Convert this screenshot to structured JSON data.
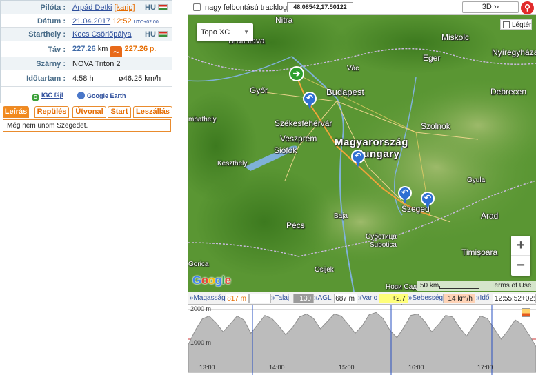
{
  "pilot": {
    "label": "Pilóta :",
    "name": "Árpád Detki",
    "nick": "[karip]",
    "country": "HU"
  },
  "date": {
    "label": "Dátum :",
    "date": "21.04.2017",
    "time": "12:52",
    "tz": "UTC+02:00"
  },
  "takeoff": {
    "label": "Starthely :",
    "name": "Kocs Csörlőpálya",
    "country": "HU"
  },
  "distance": {
    "label": "Táv :",
    "value": "227.26",
    "unit": "km",
    "points": "227.26",
    "points_unit": "p."
  },
  "glider": {
    "label": "Szárny :",
    "name": "NOVA Triton 2"
  },
  "duration": {
    "label": "Időtartam :",
    "time": "4:58 h",
    "avg": "ø46.25 km/h"
  },
  "files": {
    "igc": "IGC fájl",
    "google_earth": "Google Earth"
  },
  "tabs": [
    "Leírás",
    "Repülés",
    "Útvonal",
    "Start",
    "Leszállás"
  ],
  "active_tab": 0,
  "description": "Még nem unom Szegedet.",
  "toolbar": {
    "hires_label": "nagy felbontású tracklog",
    "coords": "48.08542,17.50122",
    "btn_3d": "3D ››"
  },
  "map": {
    "type_label": "Topo XC",
    "terrain_label": "Légtér",
    "google": "Google",
    "scale": "50 km",
    "terms": "Terms of Use",
    "zoom_in": "+",
    "zoom_out": "−",
    "cities": {
      "nitra": "Nitra",
      "bratislava": "Bratislava",
      "miskolc": "Miskolc",
      "nyiregyhaza": "Nyíregyháza",
      "eger": "Eger",
      "vac": "Vác",
      "gyor": "Győr",
      "budapest": "Budapest",
      "debrecen": "Debrecen",
      "szombathely": "mbathely",
      "szekesfehervar": "Székesfehérvár",
      "szolnok": "Szolnok",
      "veszprem": "Veszprém",
      "siofok": "Siófok",
      "country_hu": "Magyarország",
      "country_en": "Hungary",
      "keszthely": "Keszthely",
      "gyula": "Gyula",
      "szeged": "Szeged",
      "arad": "Arad",
      "baja": "Baja",
      "pecs": "Pécs",
      "subotica_cyr": "Суботица",
      "subotica": "Subotica",
      "timisoara": "Timișoara",
      "gorica": "Gorica",
      "osijek": "Osijek",
      "novisad": "Нови Сад"
    }
  },
  "readout": {
    "altitude_label": "»Magasság",
    "altitude": "817 m",
    "ground_label": "»Talaj",
    "ground": "130 m",
    "agl_label": "»AGL",
    "agl": "687 m",
    "vario_label": "»Vario",
    "vario": "+2.7 m/s",
    "speed_label": "»Sebesség",
    "speed": "14 km/h",
    "time_label": "»Idő",
    "time": "12:55:52+02:0"
  },
  "graph": {
    "y_top": "2000 m",
    "y_mid": "1000 m",
    "times": [
      "13:00",
      "14:00",
      "15:00",
      "16:00",
      "17:00"
    ],
    "altitude_m": [
      820,
      1300,
      1680,
      1780,
      1550,
      1250,
      1500,
      1780,
      1650,
      1200,
      1500,
      1800,
      1700,
      1450,
      1150,
      1400,
      1750,
      1850,
      1700,
      1350,
      1600,
      1850,
      1780,
      1500,
      1200,
      1450,
      1820,
      1900,
      1700,
      1300,
      1050,
      1400,
      1800,
      1850,
      1600,
      1250,
      1500,
      1800,
      1750,
      1400,
      1100,
      1450,
      1780,
      1700,
      1350,
      1000,
      1300,
      1650,
      1500,
      1150,
      750
    ]
  }
}
